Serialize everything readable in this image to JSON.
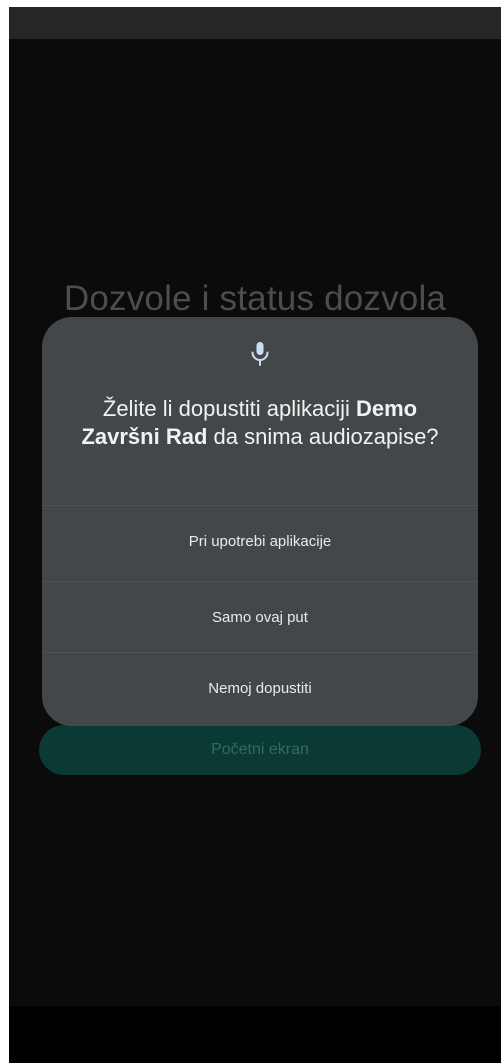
{
  "screen": {
    "title": "Dozvole i status dozvola",
    "home_button_label": "Početni ekran"
  },
  "dialog": {
    "icon": "microphone-icon",
    "question_prefix": "Želite li dopustiti aplikaciji ",
    "app_name": "Demo Završni Rad",
    "question_suffix": " da snima audiozapise?",
    "options": [
      "Pri upotrebi aplikacije",
      "Samo ovaj put",
      "Nemoj dopustiti"
    ]
  },
  "colors": {
    "background": "#0b0b0b",
    "dialog": "#43474a",
    "button": "#0a3a33",
    "button_text": "#2f6d63",
    "option_text": "#e6ebf2"
  }
}
